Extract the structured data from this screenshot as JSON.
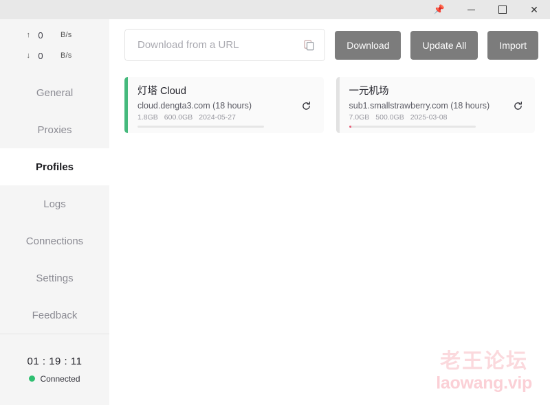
{
  "titlebar": {
    "pin_label": "Pin",
    "minimize_label": "Minimize",
    "maximize_label": "Maximize",
    "close_label": "Close"
  },
  "sidebar": {
    "speeds": [
      {
        "direction": "up",
        "arrow": "↑",
        "value": "0",
        "unit": "B/s"
      },
      {
        "direction": "down",
        "arrow": "↓",
        "value": "0",
        "unit": "B/s"
      }
    ],
    "items": [
      {
        "label": "General",
        "active": false
      },
      {
        "label": "Proxies",
        "active": false
      },
      {
        "label": "Profiles",
        "active": true
      },
      {
        "label": "Logs",
        "active": false
      },
      {
        "label": "Connections",
        "active": false
      },
      {
        "label": "Settings",
        "active": false
      },
      {
        "label": "Feedback",
        "active": false
      }
    ],
    "status": {
      "timer": "01 : 19 : 11",
      "connection_label": "Connected",
      "connection_color": "#2fbf71"
    }
  },
  "toolbar": {
    "url_placeholder": "Download from a URL",
    "url_value": "",
    "copy_icon": "copy-icon",
    "download_label": "Download",
    "update_all_label": "Update All",
    "import_label": "Import"
  },
  "profiles": [
    {
      "name": "灯塔 Cloud",
      "subtitle": "cloud.dengta3.com (18 hours)",
      "used": "1.8GB",
      "total": "600.0GB",
      "expire": "2024-05-27",
      "progress_percent": 0,
      "accent": "#45b97c",
      "active": true
    },
    {
      "name": "一元机场",
      "subtitle": "sub1.smallstrawberry.com (18 hours)",
      "used": "7.0GB",
      "total": "500.0GB",
      "expire": "2025-03-08",
      "progress_percent": 2,
      "accent": "#e8607a",
      "active": false
    }
  ],
  "watermark": {
    "cn": "老王论坛",
    "en": "laowang.vip"
  }
}
